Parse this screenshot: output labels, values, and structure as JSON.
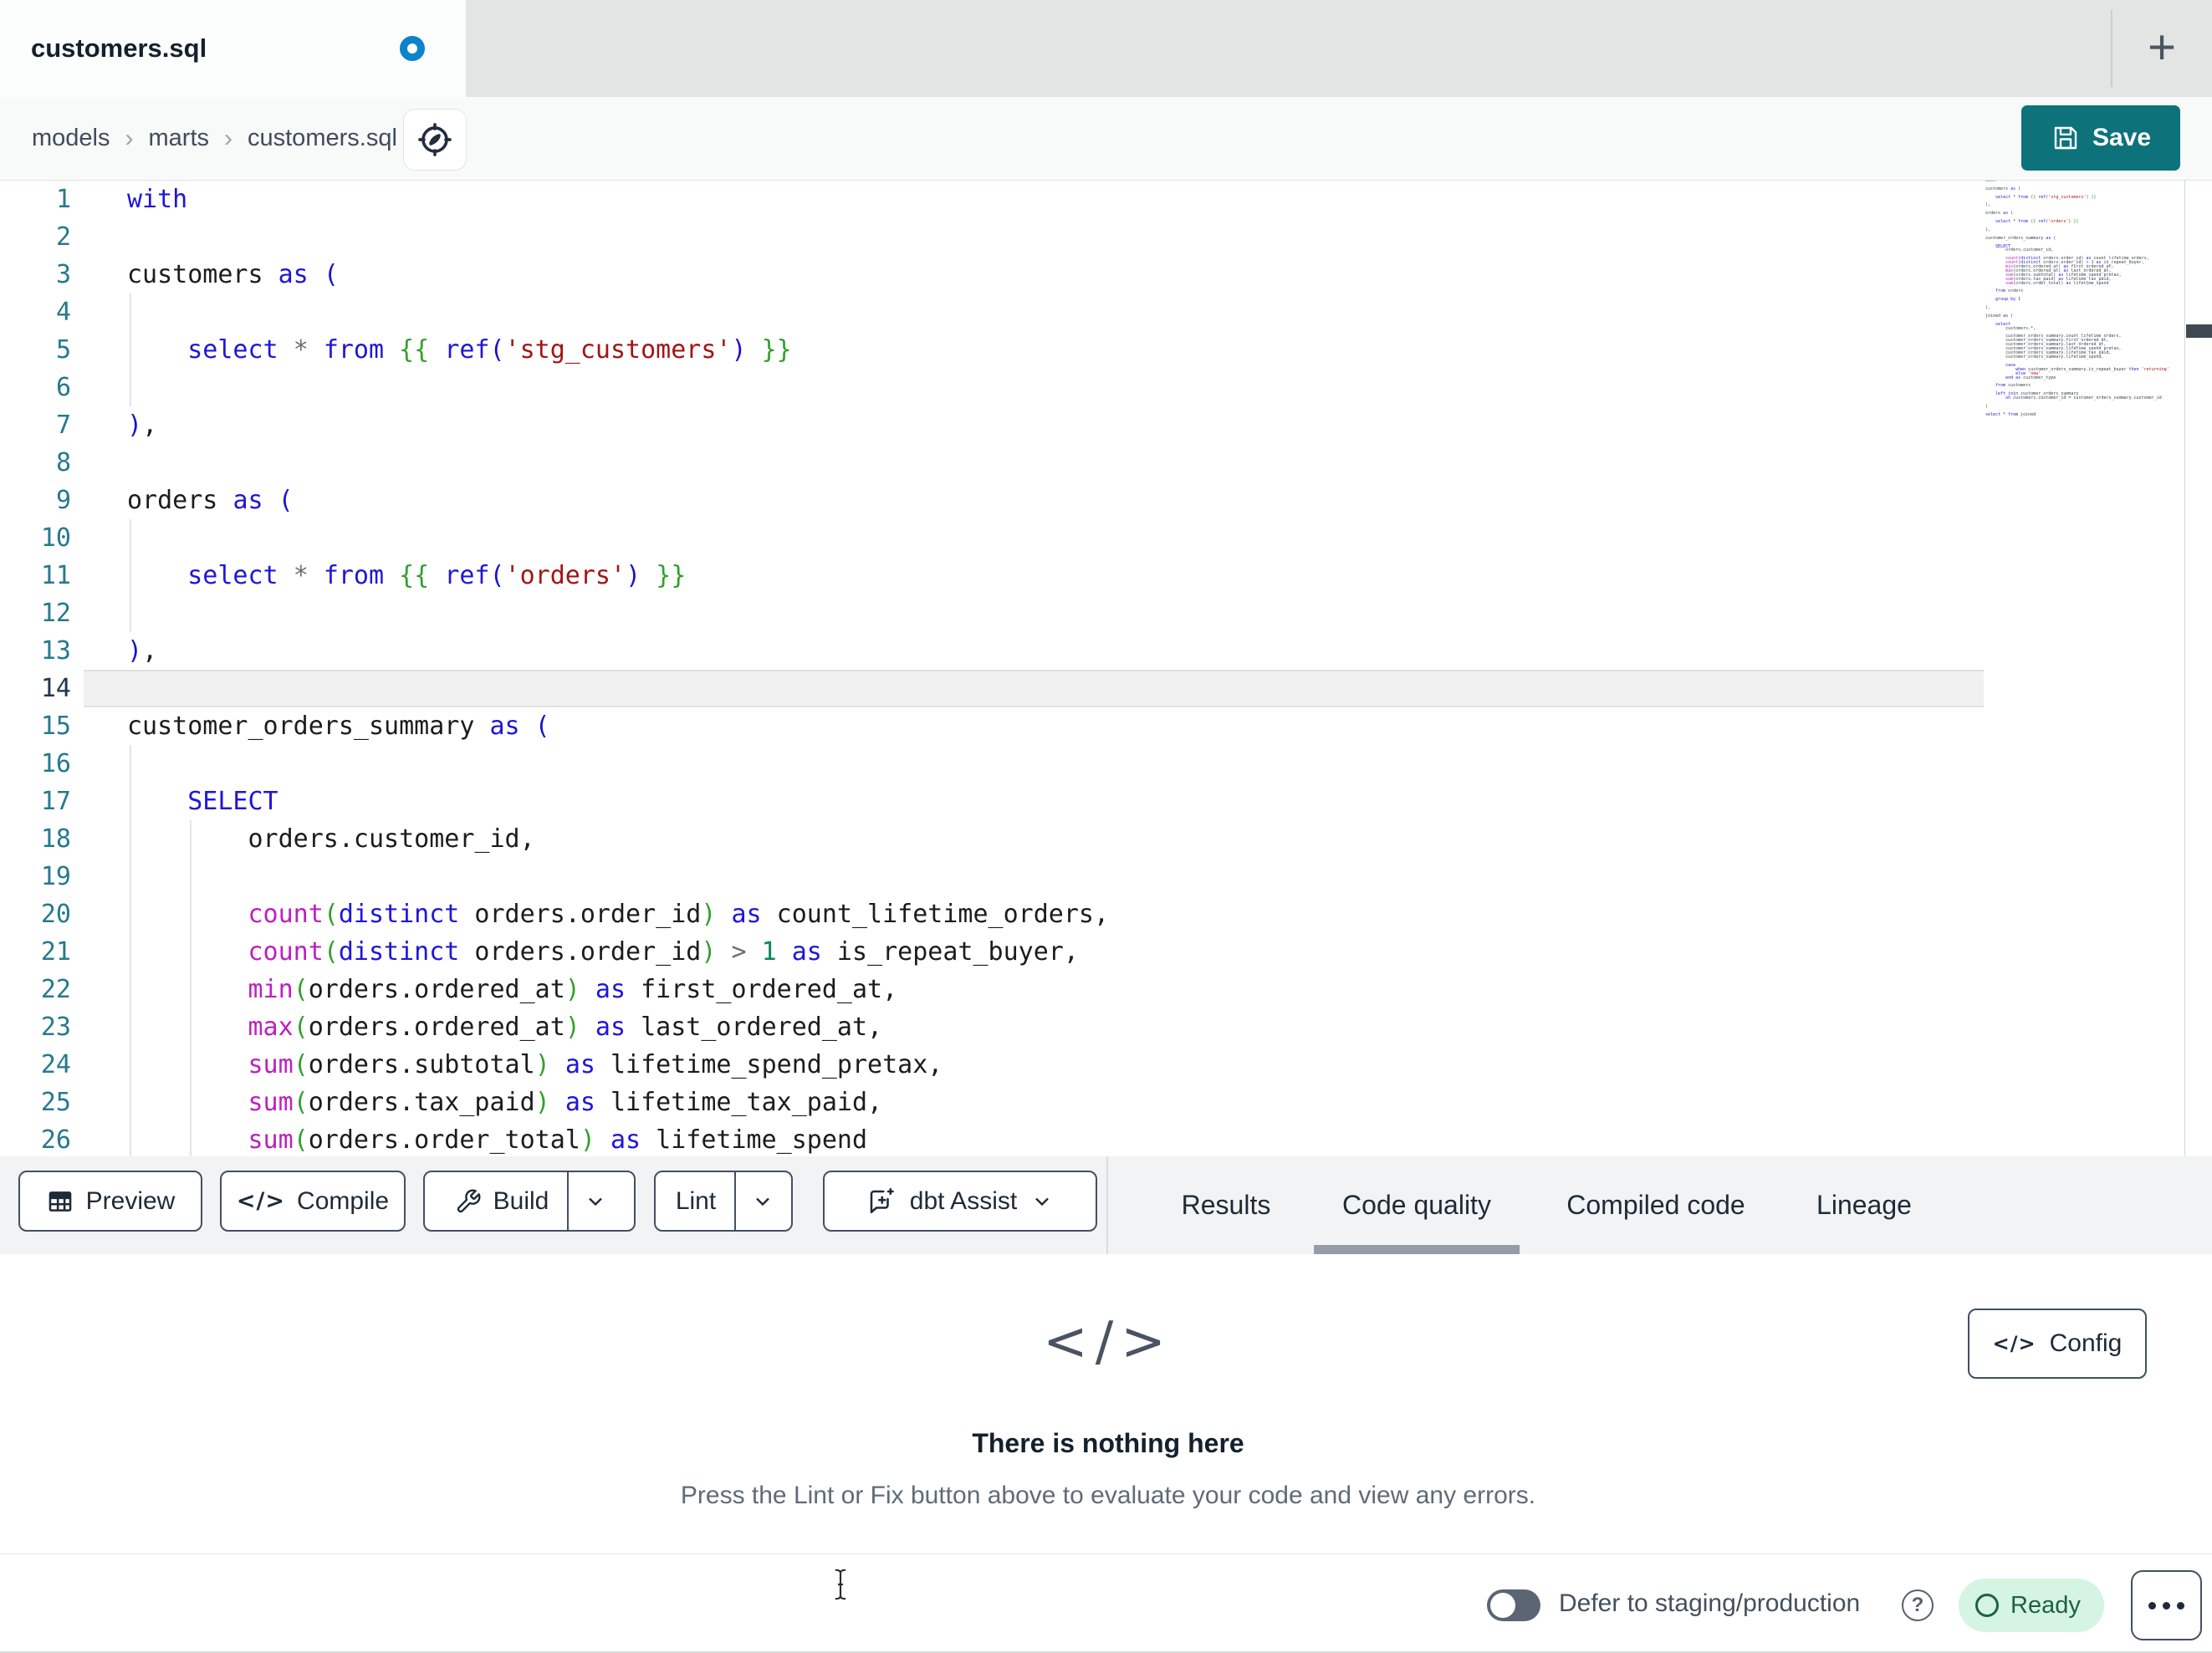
{
  "colors": {
    "accent_teal": "#0E727B",
    "unsaved_blue": "#0D83C9",
    "tabbar_bg": "#E3E4E4",
    "toolbar_bg": "#F2F3F4",
    "ready_bg": "#D5F4E3",
    "ready_fg": "#1D6145",
    "toggle_off": "#5B6573",
    "active_tab_underline": "#949CA8",
    "syntax": {
      "keyword": "#1F16D8",
      "function": "#BE1FBE",
      "string": "#A31515",
      "jinja": "#33A02C",
      "number": "#098658",
      "operator": "#6E6E6E",
      "plain": "#1C1C1C",
      "bracket": "#1A14C9",
      "fn_bracket": "#33A02C",
      "gutter": "#26798F",
      "gutter_active": "#22364C"
    }
  },
  "tabbar": {
    "tab_title": "customers.sql",
    "unsaved": true,
    "new_tab_label": "+"
  },
  "breadcrumb": {
    "items": [
      "models",
      "marts",
      "customers.sql"
    ],
    "separator": "›",
    "icon": "compass-icon"
  },
  "actions": {
    "save_label": "Save",
    "save_icon": "floppy-disk-icon"
  },
  "editor": {
    "active_line": 14,
    "visible_line_count": 26,
    "lines": [
      [
        [
          "kw",
          "with"
        ]
      ],
      [],
      [
        [
          "pl",
          "customers "
        ],
        [
          "kw",
          "as"
        ],
        [
          "pl",
          " "
        ],
        [
          "br",
          "("
        ]
      ],
      [],
      [
        [
          "pl",
          "    "
        ],
        [
          "kw",
          "select"
        ],
        [
          "pl",
          " "
        ],
        [
          "op",
          "*"
        ],
        [
          "pl",
          " "
        ],
        [
          "kw",
          "from"
        ],
        [
          "pl",
          " "
        ],
        [
          "jj",
          "{{"
        ],
        [
          "pl",
          " "
        ],
        [
          "kw",
          "ref"
        ],
        [
          "br",
          "("
        ],
        [
          "st",
          "'stg_customers'"
        ],
        [
          "br",
          ")"
        ],
        [
          "pl",
          " "
        ],
        [
          "jj",
          "}}"
        ]
      ],
      [],
      [
        [
          "br",
          ")"
        ],
        [
          "pl",
          ","
        ]
      ],
      [],
      [
        [
          "pl",
          "orders "
        ],
        [
          "kw",
          "as"
        ],
        [
          "pl",
          " "
        ],
        [
          "br",
          "("
        ]
      ],
      [],
      [
        [
          "pl",
          "    "
        ],
        [
          "kw",
          "select"
        ],
        [
          "pl",
          " "
        ],
        [
          "op",
          "*"
        ],
        [
          "pl",
          " "
        ],
        [
          "kw",
          "from"
        ],
        [
          "pl",
          " "
        ],
        [
          "jj",
          "{{"
        ],
        [
          "pl",
          " "
        ],
        [
          "kw",
          "ref"
        ],
        [
          "br",
          "("
        ],
        [
          "st",
          "'orders'"
        ],
        [
          "br",
          ")"
        ],
        [
          "pl",
          " "
        ],
        [
          "jj",
          "}}"
        ]
      ],
      [],
      [
        [
          "br",
          ")"
        ],
        [
          "pl",
          ","
        ]
      ],
      [],
      [
        [
          "pl",
          "customer_orders_summary "
        ],
        [
          "kw",
          "as"
        ],
        [
          "pl",
          " "
        ],
        [
          "br",
          "("
        ]
      ],
      [],
      [
        [
          "pl",
          "    "
        ],
        [
          "kw",
          "SELECT"
        ]
      ],
      [
        [
          "pl",
          "        orders.customer_id,"
        ]
      ],
      [],
      [
        [
          "pl",
          "        "
        ],
        [
          "fn",
          "count"
        ],
        [
          "fb",
          "("
        ],
        [
          "kw",
          "distinct"
        ],
        [
          "pl",
          " orders.order_id"
        ],
        [
          "fb",
          ")"
        ],
        [
          "pl",
          " "
        ],
        [
          "kw",
          "as"
        ],
        [
          "pl",
          " count_lifetime_orders,"
        ]
      ],
      [
        [
          "pl",
          "        "
        ],
        [
          "fn",
          "count"
        ],
        [
          "fb",
          "("
        ],
        [
          "kw",
          "distinct"
        ],
        [
          "pl",
          " orders.order_id"
        ],
        [
          "fb",
          ")"
        ],
        [
          "pl",
          " "
        ],
        [
          "op",
          ">"
        ],
        [
          "pl",
          " "
        ],
        [
          "nu",
          "1"
        ],
        [
          "pl",
          " "
        ],
        [
          "kw",
          "as"
        ],
        [
          "pl",
          " is_repeat_buyer,"
        ]
      ],
      [
        [
          "pl",
          "        "
        ],
        [
          "fn",
          "min"
        ],
        [
          "fb",
          "("
        ],
        [
          "pl",
          "orders.ordered_at"
        ],
        [
          "fb",
          ")"
        ],
        [
          "pl",
          " "
        ],
        [
          "kw",
          "as"
        ],
        [
          "pl",
          " first_ordered_at,"
        ]
      ],
      [
        [
          "pl",
          "        "
        ],
        [
          "fn",
          "max"
        ],
        [
          "fb",
          "("
        ],
        [
          "pl",
          "orders.ordered_at"
        ],
        [
          "fb",
          ")"
        ],
        [
          "pl",
          " "
        ],
        [
          "kw",
          "as"
        ],
        [
          "pl",
          " last_ordered_at,"
        ]
      ],
      [
        [
          "pl",
          "        "
        ],
        [
          "fn",
          "sum"
        ],
        [
          "fb",
          "("
        ],
        [
          "pl",
          "orders.subtotal"
        ],
        [
          "fb",
          ")"
        ],
        [
          "pl",
          " "
        ],
        [
          "kw",
          "as"
        ],
        [
          "pl",
          " lifetime_spend_pretax,"
        ]
      ],
      [
        [
          "pl",
          "        "
        ],
        [
          "fn",
          "sum"
        ],
        [
          "fb",
          "("
        ],
        [
          "pl",
          "orders.tax_paid"
        ],
        [
          "fb",
          ")"
        ],
        [
          "pl",
          " "
        ],
        [
          "kw",
          "as"
        ],
        [
          "pl",
          " lifetime_tax_paid,"
        ]
      ],
      [
        [
          "pl",
          "        "
        ],
        [
          "fn",
          "sum"
        ],
        [
          "fb",
          "("
        ],
        [
          "pl",
          "orders.order_total"
        ],
        [
          "fb",
          ")"
        ],
        [
          "pl",
          " "
        ],
        [
          "kw",
          "as"
        ],
        [
          "pl",
          " lifetime_spend"
        ]
      ]
    ],
    "indent_guides": [
      {
        "col": 0,
        "from": 4,
        "to": 6
      },
      {
        "col": 0,
        "from": 10,
        "to": 12
      },
      {
        "col": 0,
        "from": 16,
        "to": 26
      },
      {
        "col": 4,
        "from": 18,
        "to": 26
      }
    ],
    "minimap_text": "with\n\ncustomers as (\n\n    select * from {{ ref('stg_customers') }}\n\n),\n\norders as (\n\n    select * from {{ ref('orders') }}\n\n),\n\ncustomer_orders_summary as (\n\n    SELECT\n        orders.customer_id,\n\n        count(distinct orders.order_id) as count_lifetime_orders,\n        count(distinct orders.order_id) > 1 as is_repeat_buyer,\n        min(orders.ordered_at) as first_ordered_at,\n        max(orders.ordered_at) as last_ordered_at,\n        sum(orders.subtotal) as lifetime_spend_pretax,\n        sum(orders.tax_paid) as lifetime_tax_paid,\n        sum(orders.order_total) as lifetime_spend\n\n    from orders\n\n    group by 1\n\n),\n\njoined as (\n\n    select\n        customers.*,\n\n        customer_orders_summary.count_lifetime_orders,\n        customer_orders_summary.first_ordered_at,\n        customer_orders_summary.last_ordered_at,\n        customer_orders_summary.lifetime_spend_pretax,\n        customer_orders_summary.lifetime_tax_paid,\n        customer_orders_summary.lifetime_spend,\n\n        case\n            when customer_orders_summary.is_repeat_buyer then 'returning'\n            else 'new'\n        end as customer_type\n\n    from customers\n\n    left join customer_orders_summary\n        on customers.customer_id = customer_orders_summary.customer_id\n\n)\n\nselect * from joined"
  },
  "toolbar": {
    "buttons": [
      {
        "label": "Preview",
        "icon": "table-icon"
      },
      {
        "label": "Compile",
        "icon": "code-icon"
      },
      {
        "label": "Build",
        "icon": "wrench-icon",
        "split": true
      },
      {
        "label": "Lint",
        "split": true
      },
      {
        "label": "dbt Assist",
        "icon": "assist-sparkle-icon",
        "chevron": true
      }
    ]
  },
  "result_tabs": [
    {
      "label": "Results",
      "active": false
    },
    {
      "label": "Code quality",
      "active": true
    },
    {
      "label": "Compiled code",
      "active": false
    },
    {
      "label": "Lineage",
      "active": false
    }
  ],
  "panel": {
    "icon_glyph": "</>",
    "title": "There is nothing here",
    "description": "Press the Lint or Fix button above to evaluate your code and view any errors.",
    "config_label": "Config"
  },
  "statusbar": {
    "defer_label": "Defer to staging/production",
    "defer_on": false,
    "status_label": "Ready",
    "help_icon": "question-circle-icon",
    "menu_icon": "ellipsis-icon"
  }
}
